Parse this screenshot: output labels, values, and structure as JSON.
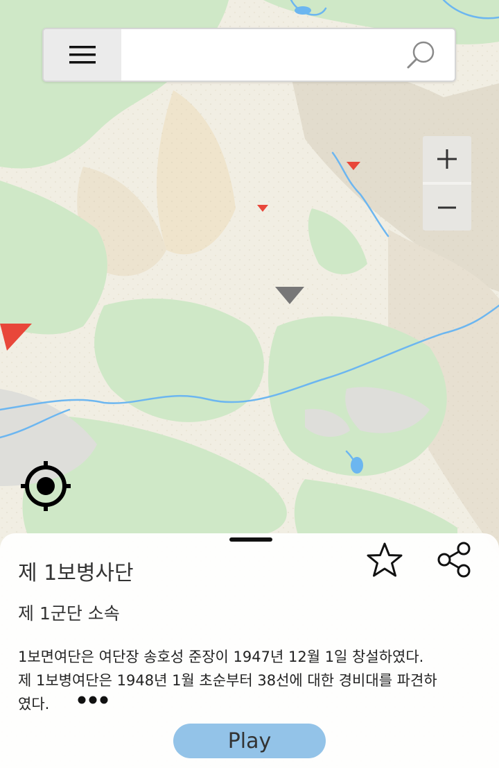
{
  "search": {
    "placeholder": "",
    "value": ""
  },
  "zoom": {
    "in_label": "+",
    "out_label": "−"
  },
  "panel": {
    "title": "제 1보병사단",
    "subtitle": "제 1군단 소속",
    "description_lines": [
      "1보면여단은 여단장 송호성 준장이 1947년 12월 1일 창설하였다.",
      "제 1보병여단은 1948년 1월 초순부터 38선에 대한 경비대를 파견하",
      "였다."
    ],
    "play_label": "Play"
  },
  "colors": {
    "marker_red": "#e8473a",
    "marker_gray": "#777777",
    "play_button": "#93c3e8",
    "land": "#f1eee3",
    "forest": "#cfe8c7",
    "water": "#6cb6f0"
  },
  "icons": {
    "menu": "hamburger-icon",
    "search": "magnifier-icon",
    "locate": "crosshair-target-icon",
    "favorite": "star-outline-icon",
    "share": "share-icon",
    "more": "ellipsis-icon"
  }
}
